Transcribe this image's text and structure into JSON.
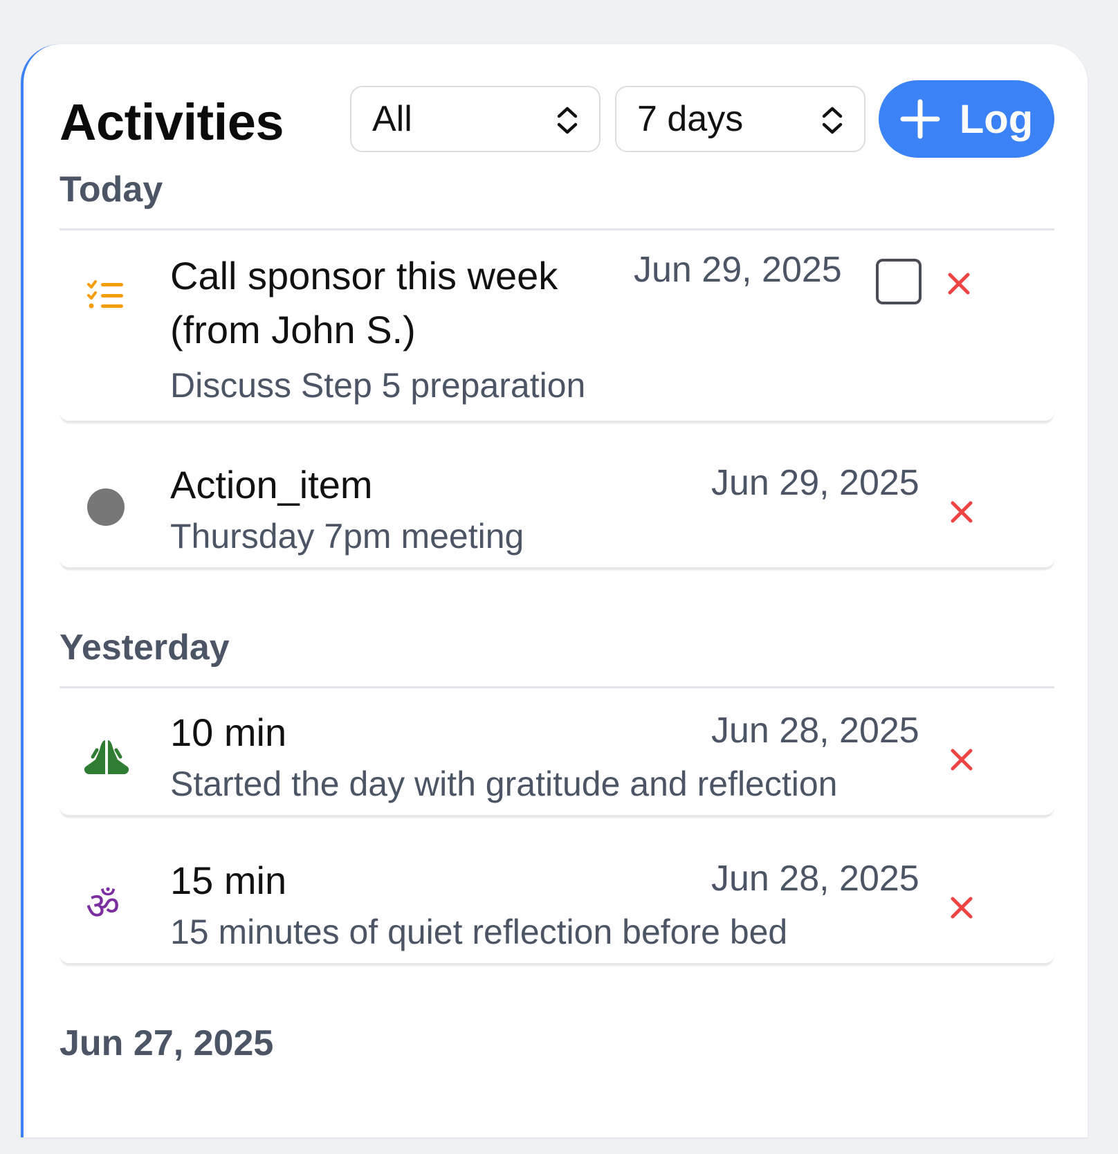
{
  "header": {
    "title": "Activities",
    "type_filter": "All",
    "range_filter": "7 days",
    "log_label": "Log"
  },
  "sections": [
    {
      "heading": "Today",
      "items": [
        {
          "title_line1": "Call sponsor this week",
          "title_line2": "(from John S.)",
          "date": "Jun 29, 2025",
          "description": "Discuss Step 5 preparation",
          "icon": "checklist-icon",
          "has_checkbox": true
        },
        {
          "title": "Action_item",
          "date": "Jun 29, 2025",
          "description": "Thursday 7pm meeting",
          "icon": "gray-dot-icon"
        }
      ]
    },
    {
      "heading": "Yesterday",
      "items": [
        {
          "title": "10 min",
          "date": "Jun 28, 2025",
          "description": "Started the day with gratitude and reflection",
          "icon": "praying-hands-icon"
        },
        {
          "title": "15 min",
          "date": "Jun 28, 2025",
          "description": "15 minutes of quiet reflection before bed",
          "icon": "om-icon",
          "icon_glyph": "ॐ"
        }
      ]
    },
    {
      "heading": "Jun 27, 2025",
      "items": []
    }
  ],
  "colors": {
    "accent": "#3b82f6",
    "delete": "#ef4444",
    "checklist": "#f59e0b",
    "praying": "#2e7d32",
    "om": "#7b2ea0"
  }
}
